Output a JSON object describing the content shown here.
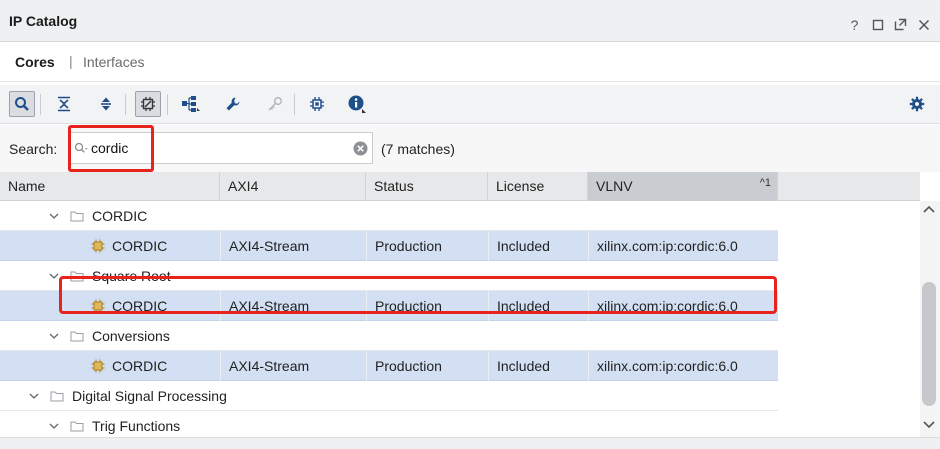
{
  "window": {
    "title": "IP Catalog",
    "controls": [
      "?",
      "restore",
      "float",
      "close"
    ]
  },
  "tabs": {
    "active": "Cores",
    "separator": "|",
    "inactive": "Interfaces"
  },
  "toolbar": {
    "buttons": [
      "search-icon",
      "collapse-all-icon",
      "expand-all-icon",
      "filter-icon",
      "hierarchy-icon",
      "wrench-icon",
      "key-icon",
      "chip-icon",
      "info-icon",
      "gear-icon"
    ]
  },
  "search": {
    "label": "Search:",
    "value": "cordic",
    "matches": "(7 matches)"
  },
  "table": {
    "columns": [
      "Name",
      "AXI4",
      "Status",
      "License",
      "VLNV"
    ],
    "sort_indicator": "^1",
    "rows": [
      {
        "type": "folder",
        "name": "CORDIC"
      },
      {
        "type": "leaf",
        "name": "CORDIC",
        "axi4": "AXI4-Stream",
        "status": "Production",
        "license": "Included",
        "vlnv": "xilinx.com:ip:cordic:6.0"
      },
      {
        "type": "folder",
        "name": "Square Root"
      },
      {
        "type": "leaf",
        "name": "CORDIC",
        "axi4": "AXI4-Stream",
        "status": "Production",
        "license": "Included",
        "vlnv": "xilinx.com:ip:cordic:6.0"
      },
      {
        "type": "folder",
        "name": "Conversions"
      },
      {
        "type": "leaf",
        "name": "CORDIC",
        "axi4": "AXI4-Stream",
        "status": "Production",
        "license": "Included",
        "vlnv": "xilinx.com:ip:cordic:6.0"
      },
      {
        "type": "folder",
        "name": "Digital Signal Processing"
      },
      {
        "type": "folder",
        "name": "Trig Functions"
      }
    ]
  },
  "colors": {
    "highlight": "#e8221c",
    "selected_row": "#d3e0f4",
    "sorted_header": "#c9ccd0"
  }
}
